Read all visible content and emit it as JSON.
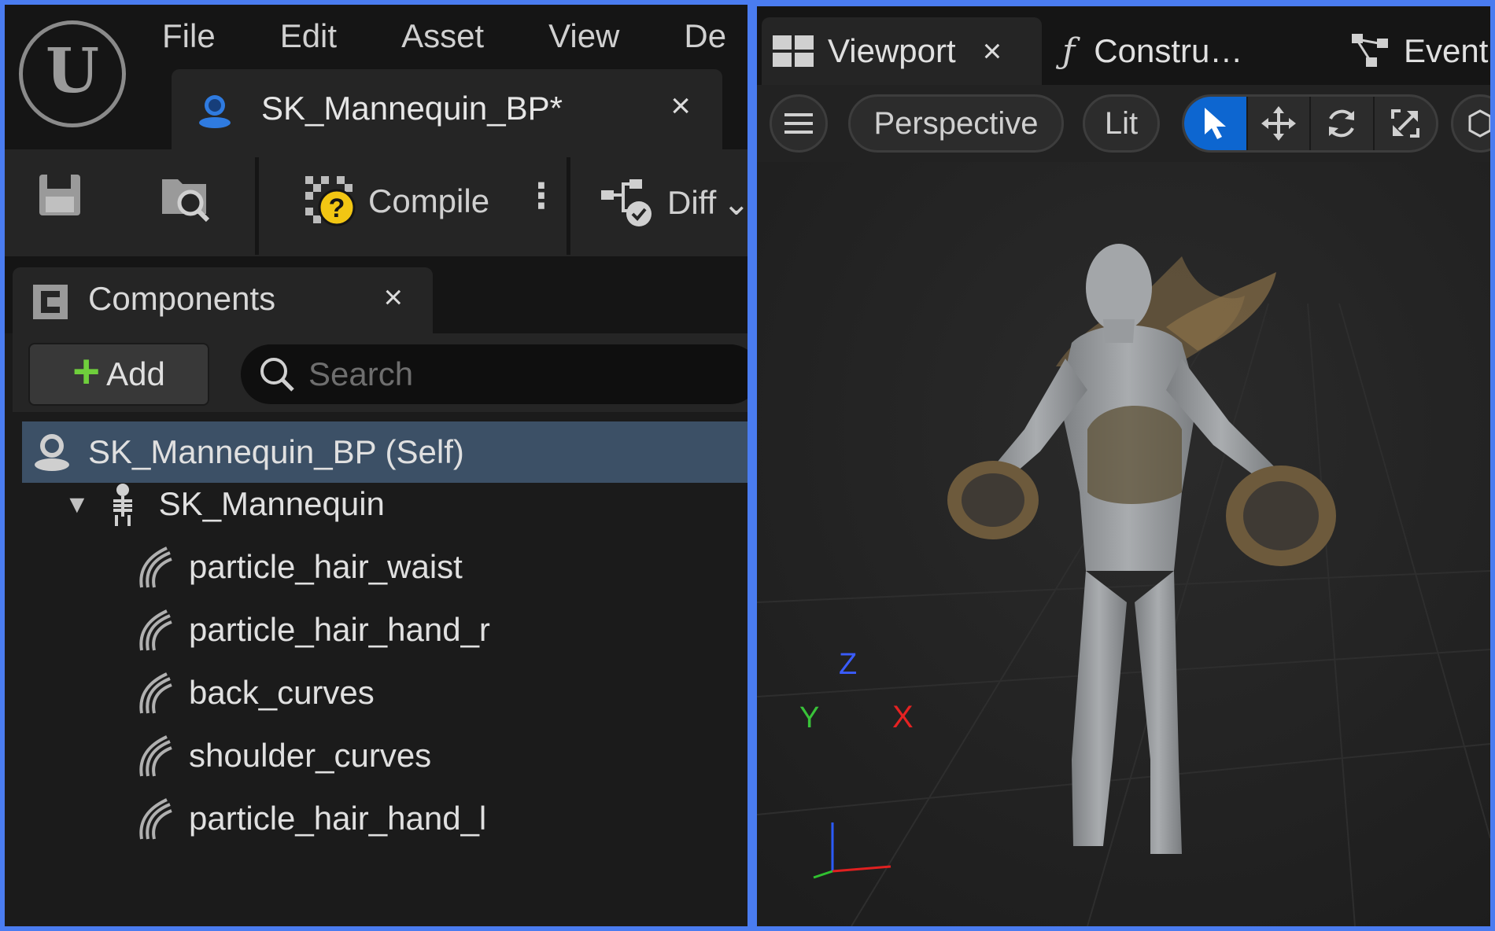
{
  "menu": [
    "File",
    "Edit",
    "Asset",
    "View",
    "De"
  ],
  "document_tab": {
    "label": "SK_Mannequin_BP*",
    "close": "×"
  },
  "toolbar": {
    "compile_label": "Compile",
    "more": "⋮",
    "diff_label": "Diff",
    "diff_arrow": "⌄"
  },
  "components_panel": {
    "tab_label": "Components",
    "close": "×",
    "add_label": "Add",
    "add_plus": "+",
    "search_placeholder": "Search",
    "tree": [
      {
        "label": "SK_Mannequin_BP (Self)",
        "icon": "blueprint-pawn-icon",
        "level": 0,
        "selected": true
      },
      {
        "label": "SK_Mannequin",
        "icon": "skeleton-icon",
        "level": 1,
        "expanded": true
      },
      {
        "label": "particle_hair_waist",
        "icon": "groom-icon",
        "level": 2
      },
      {
        "label": "particle_hair_hand_r",
        "icon": "groom-icon",
        "level": 2
      },
      {
        "label": "back_curves",
        "icon": "groom-icon",
        "level": 2
      },
      {
        "label": "shoulder_curves",
        "icon": "groom-icon",
        "level": 2
      },
      {
        "label": "particle_hair_hand_l",
        "icon": "groom-icon",
        "level": 2
      }
    ]
  },
  "viewport_tabs": [
    {
      "label": "Viewport",
      "close": "×",
      "active": true
    },
    {
      "label": "Constru…",
      "active": false
    },
    {
      "label": "Event",
      "active": false
    }
  ],
  "viewport_toolbar": {
    "perspective_label": "Perspective",
    "lit_label": "Lit"
  },
  "axis_labels": {
    "z": "Z",
    "y": "Y",
    "x": "X"
  },
  "colors": {
    "accent_blue": "#0d66d0",
    "selection": "#3c5066",
    "frame": "#4a7cf0",
    "add_green": "#6fcf3c"
  }
}
